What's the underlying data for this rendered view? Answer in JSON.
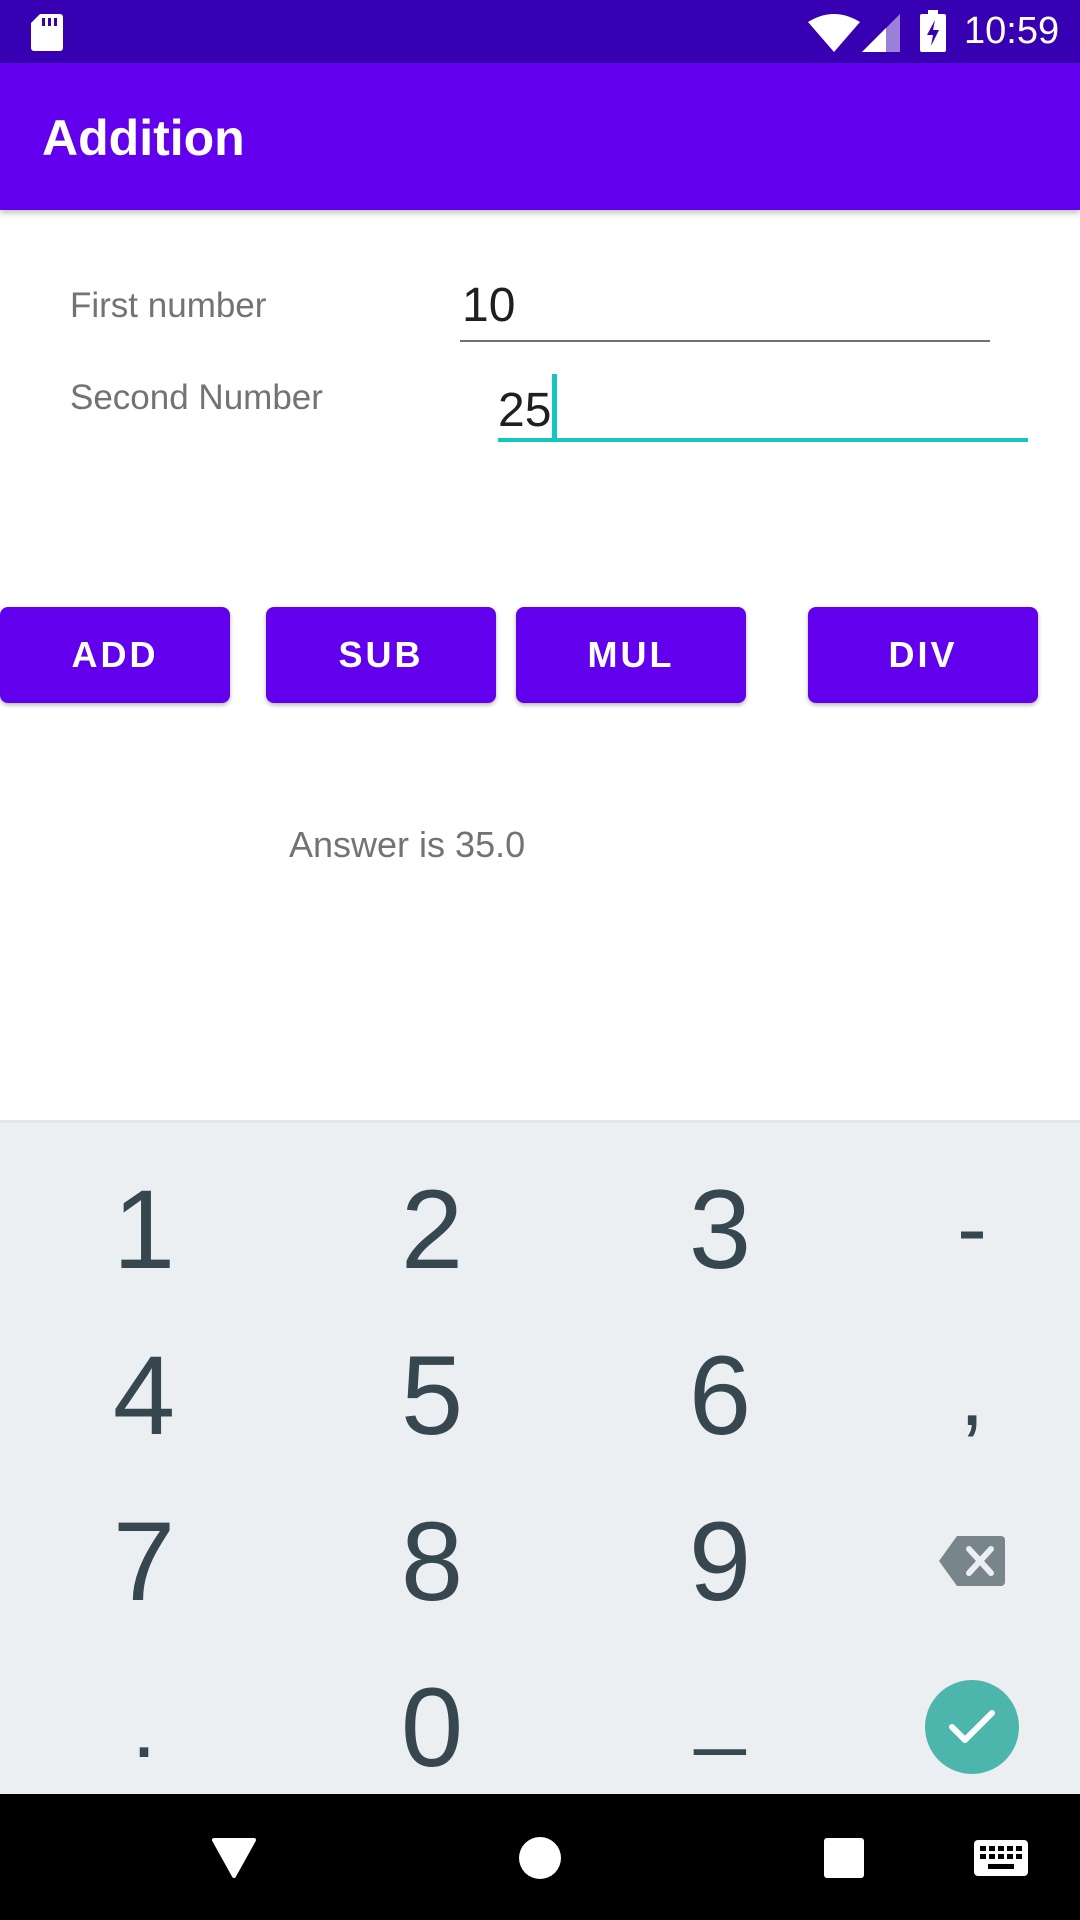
{
  "status_bar": {
    "time": "10:59",
    "icons": [
      "sd-card-icon",
      "wifi-icon",
      "cell-signal-icon",
      "battery-charging-icon"
    ]
  },
  "app_bar": {
    "title": "Addition",
    "color": "#6200ee"
  },
  "form": {
    "first_label": "First number",
    "first_value": "10",
    "second_label": "Second Number",
    "second_value": "25"
  },
  "buttons": {
    "add": "ADD",
    "sub": "SUB",
    "mul": "MUL",
    "div": "DIV"
  },
  "answer": "Answer is 35.0",
  "keyboard": {
    "rows": [
      [
        "1",
        "2",
        "3",
        "-"
      ],
      [
        "4",
        "5",
        "6",
        ","
      ],
      [
        "7",
        "8",
        "9",
        "backspace-icon"
      ],
      [
        ".",
        "0",
        "_",
        "done-check-icon"
      ]
    ]
  },
  "nav_bar": {
    "icons": [
      "back-icon",
      "home-icon",
      "recents-icon",
      "keyboard-switch-icon"
    ]
  },
  "colors": {
    "status_bar": "#3700b3",
    "primary": "#6200ee",
    "accent": "#14c7c0",
    "keyboard_bg": "#eceff1",
    "done_button": "#4db6ac"
  }
}
